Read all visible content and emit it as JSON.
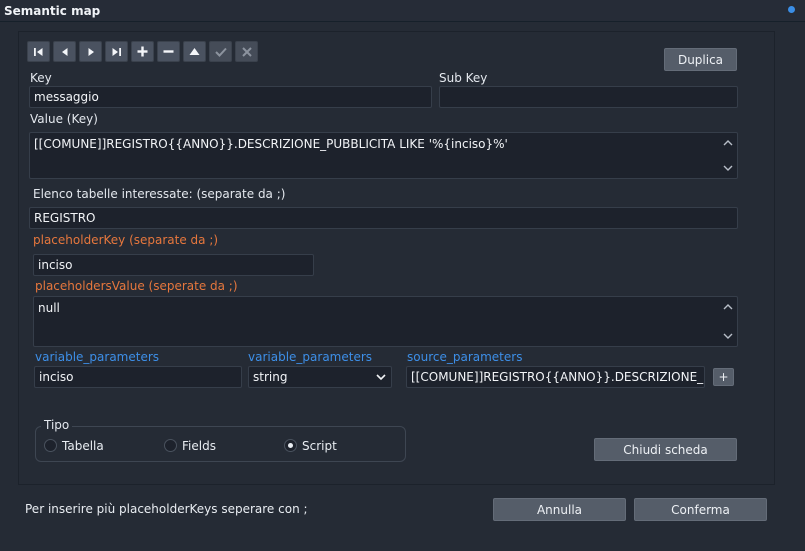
{
  "window": {
    "title": "Semantic map"
  },
  "toolbar": [
    {
      "name": "first-record-button",
      "icon": "first-icon"
    },
    {
      "name": "prev-record-button",
      "icon": "prev-icon"
    },
    {
      "name": "next-record-button",
      "icon": "next-icon"
    },
    {
      "name": "last-record-button",
      "icon": "last-icon"
    },
    {
      "name": "add-record-button",
      "icon": "plus-icon"
    },
    {
      "name": "remove-record-button",
      "icon": "minus-icon"
    },
    {
      "name": "move-up-button",
      "icon": "triangle-up-icon"
    },
    {
      "name": "confirm-edit-button",
      "icon": "check-icon"
    },
    {
      "name": "cancel-edit-button",
      "icon": "x-icon"
    }
  ],
  "duplica_label": "Duplica",
  "key": {
    "label": "Key",
    "value": "messaggio"
  },
  "sub_key": {
    "label": "Sub Key",
    "value": ""
  },
  "value_key": {
    "label": "Value (Key)",
    "value": "[[COMUNE]]REGISTRO{{ANNO}}.DESCRIZIONE_PUBBLICITA LIKE '%{inciso}%'"
  },
  "tables": {
    "label": "Elenco tabelle interessate: (separate da ;)",
    "value": "REGISTRO"
  },
  "placeholder_key": {
    "label": "placeholderKey (separate da ;)",
    "value": "inciso"
  },
  "placeholders_value": {
    "label": "placeholdersValue (seperate da ;)",
    "value": "null"
  },
  "variable_parameters_1": {
    "label": "variable_parameters",
    "value": "inciso"
  },
  "variable_parameters_2": {
    "label": "variable_parameters",
    "value": "string"
  },
  "source_parameters": {
    "label": "source_parameters",
    "value": "[[COMUNE]]REGISTRO{{ANNO}}.DESCRIZIONE_PUBBLICITA",
    "add_label": "+"
  },
  "tipo": {
    "label": "Tipo",
    "options": [
      "Tabella",
      "Fields",
      "Script"
    ],
    "selected": "Script"
  },
  "chiudi_label": "Chiudi scheda",
  "footer": {
    "note": "Per inserire più placeholderKeys seperare con ;",
    "annulla_label": "Annulla",
    "conferma_label": "Conferma"
  },
  "colors": {
    "accent_orange": "#e6773d",
    "accent_blue": "#3d8fe8",
    "background": "#252b35",
    "input_bg": "#1d222c",
    "button_bg": "#555d69"
  }
}
